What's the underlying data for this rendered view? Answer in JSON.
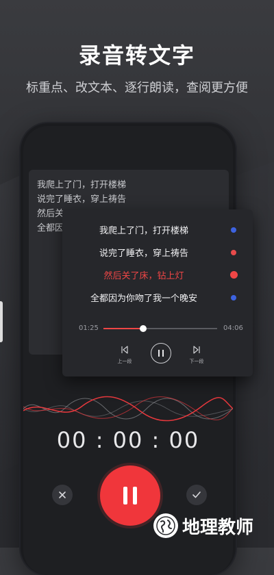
{
  "header": {
    "title": "录音转文字",
    "subtitle": "标重点、改文本、逐行朗读，查阅更方便"
  },
  "transcript": {
    "lines": [
      "我爬上了门，打开楼梯",
      "说完了睡衣，穿上祷告",
      "然后关",
      "全都因"
    ]
  },
  "card": {
    "lines": [
      {
        "text": "我爬上了门，打开楼梯",
        "dot_color": "#3d63e0"
      },
      {
        "text": "说完了睡衣，穿上祷告",
        "dot_color": "#e84b4b"
      },
      {
        "text": "然后关了床，钻上灯",
        "dot_color": "#f04646"
      },
      {
        "text": "全都因为你吻了我一个晚安",
        "dot_color": "#3d63e0"
      }
    ],
    "active_index": 2,
    "time_current": "01:25",
    "time_total": "04:06",
    "progress": 0.35,
    "prev_label": "上一段",
    "next_label": "下一段"
  },
  "recorder": {
    "timer": "00 : 00 : 00"
  },
  "colors": {
    "accent_red": "#f0363b",
    "blue_dot": "#3d63e0"
  },
  "watermark": {
    "text": "地理教师"
  }
}
